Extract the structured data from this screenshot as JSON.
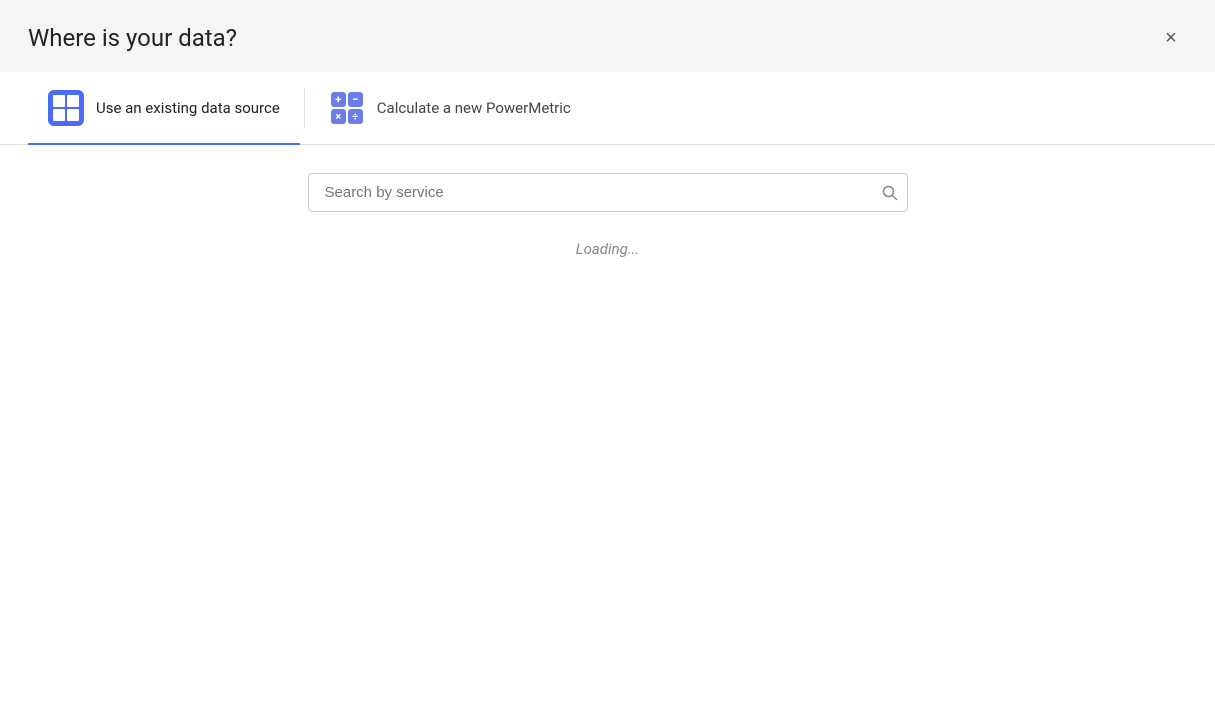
{
  "modal": {
    "title": "Where is your data?",
    "close_label": "×"
  },
  "tabs": [
    {
      "id": "existing",
      "label": "Use an existing data source",
      "icon_type": "grid",
      "active": true
    },
    {
      "id": "new",
      "label": "Calculate a new PowerMetric",
      "icon_type": "calc",
      "active": false
    }
  ],
  "search": {
    "placeholder": "Search by service",
    "value": ""
  },
  "status": {
    "loading_text": "Loading..."
  },
  "icons": {
    "search": "🔍",
    "close": "✕",
    "plus": "+",
    "minus": "−",
    "multiply": "×",
    "divide": "÷"
  }
}
